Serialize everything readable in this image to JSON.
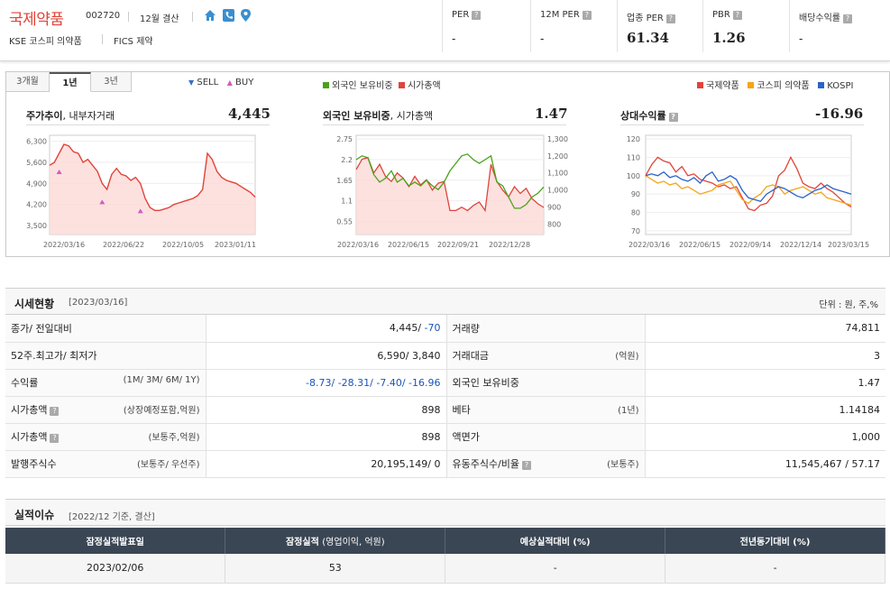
{
  "company": {
    "name": "국제약품",
    "code": "002720",
    "settlement": "12월 결산",
    "market": "KSE  코스피 의약품",
    "fics": "FICS 제약",
    "icons": [
      "home-icon",
      "phone-icon",
      "location-pin-icon"
    ]
  },
  "metrics": [
    {
      "label": "PER",
      "value": "-"
    },
    {
      "label": "12M PER",
      "value": "-"
    },
    {
      "label": "업종 PER",
      "value": "61.34"
    },
    {
      "label": "PBR",
      "value": "1.26"
    },
    {
      "label": "배당수익률",
      "value": "-"
    }
  ],
  "period_tabs": [
    "3개월",
    "1년",
    "3년"
  ],
  "active_tab": "1년",
  "legends": {
    "trade": [
      "SELL",
      "BUY"
    ],
    "foreign": [
      "외국인 보유비중",
      "시가총액"
    ],
    "relative": [
      "국제약품",
      "코스피 의약품",
      "KOSPI"
    ]
  },
  "colors": {
    "red": "#e0443a",
    "green": "#4aa21a",
    "orange": "#f5a418",
    "blue": "#2b63c8",
    "buy": "#d05bc4",
    "sell": "#3a6fc9"
  },
  "charts": {
    "price": {
      "title": "주가추이",
      "subtitle": ", 내부자거래",
      "value": "4,445"
    },
    "foreign": {
      "title": "외국인 보유비중",
      "subtitle": ", 시가총액",
      "value": "1.47"
    },
    "relative": {
      "title": "상대수익률",
      "value": "-16.96"
    }
  },
  "chart_data": [
    {
      "type": "area",
      "title": "주가추이, 내부자거래",
      "x_ticks": [
        "2022/03/16",
        "2022/06/22",
        "2022/10/05",
        "2023/01/11"
      ],
      "y_ticks": [
        6300,
        5600,
        4900,
        4200,
        3500
      ],
      "ylim": [
        3200,
        6500
      ],
      "series": [
        {
          "name": "주가",
          "values": [
            5500,
            5600,
            5900,
            6200,
            6150,
            5950,
            5900,
            5600,
            5700,
            5500,
            5300,
            4900,
            4700,
            5200,
            5400,
            5200,
            5150,
            5000,
            5100,
            4900,
            4400,
            4100,
            4000,
            4000,
            4050,
            4100,
            4200,
            4250,
            4300,
            4350,
            4400,
            4500,
            4700,
            5900,
            5700,
            5300,
            5100,
            5000,
            4950,
            4900,
            4800,
            4700,
            4600,
            4445
          ]
        }
      ],
      "markers": [
        {
          "type": "BUY",
          "index": 2
        },
        {
          "type": "BUY",
          "index": 11
        },
        {
          "type": "BUY",
          "index": 19
        }
      ]
    },
    {
      "type": "line",
      "title": "외국인 보유비중, 시가총액",
      "x_ticks": [
        "2022/03/16",
        "2022/06/15",
        "2022/09/21",
        "2022/12/28"
      ],
      "y_left_ticks": [
        2.75,
        2.2,
        1.65,
        1.1,
        0.55
      ],
      "y_right_ticks": [
        1300,
        1200,
        1100,
        1000,
        900,
        800
      ],
      "series": [
        {
          "name": "외국인 보유비중",
          "values": [
            2.2,
            2.3,
            2.25,
            1.8,
            1.6,
            1.7,
            1.9,
            1.6,
            1.7,
            1.5,
            1.6,
            1.5,
            1.65,
            1.5,
            1.4,
            1.6,
            1.9,
            2.1,
            2.3,
            2.35,
            2.2,
            2.1,
            2.2,
            2.3,
            1.6,
            1.5,
            1.2,
            0.9,
            0.9,
            1.0,
            1.2,
            1.3,
            1.47
          ]
        },
        {
          "name": "시가총액",
          "values": [
            1120,
            1180,
            1190,
            1100,
            1150,
            1080,
            1050,
            1100,
            1070,
            1020,
            1080,
            1030,
            1060,
            1000,
            1040,
            1050,
            880,
            880,
            900,
            880,
            910,
            930,
            880,
            1150,
            1050,
            1000,
            960,
            1020,
            980,
            1010,
            950,
            920,
            898
          ]
        }
      ]
    },
    {
      "type": "line",
      "title": "상대수익률",
      "x_ticks": [
        "2022/03/16",
        "2022/06/15",
        "2022/09/14",
        "2022/12/14",
        "2023/03/15"
      ],
      "y_ticks": [
        120,
        110,
        100,
        90,
        80,
        70
      ],
      "series": [
        {
          "name": "국제약품",
          "values": [
            100,
            106,
            110,
            108,
            107,
            102,
            105,
            100,
            101,
            98,
            97,
            96,
            94,
            95,
            93,
            94,
            88,
            82,
            81,
            84,
            85,
            89,
            100,
            103,
            110,
            104,
            96,
            94,
            93,
            96,
            93,
            91,
            88,
            85,
            83
          ]
        },
        {
          "name": "코스피 의약품",
          "values": [
            100,
            98,
            96,
            97,
            95,
            96,
            93,
            94,
            92,
            90,
            91,
            92,
            95,
            96,
            97,
            92,
            87,
            85,
            88,
            90,
            94,
            95,
            94,
            90,
            92,
            93,
            94,
            92,
            90,
            91,
            88,
            87,
            86,
            85,
            84
          ]
        },
        {
          "name": "KOSPI",
          "values": [
            100,
            101,
            100,
            102,
            99,
            100,
            98,
            97,
            99,
            96,
            100,
            102,
            97,
            98,
            100,
            98,
            92,
            88,
            87,
            86,
            90,
            92,
            94,
            93,
            91,
            89,
            88,
            90,
            92,
            93,
            95,
            93,
            92,
            91,
            90
          ]
        }
      ]
    }
  ],
  "market_status": {
    "title": "시세현황",
    "date": "[2023/03/16]",
    "unit": "단위 : 원, 주,%",
    "rows": [
      {
        "l_label": "종가/ 전일대비",
        "l_hint": "",
        "l_value": "4,445/",
        "l_value2": " -70",
        "r_label": "거래량",
        "r_hint": "",
        "r_value": "74,811"
      },
      {
        "l_label": "52주.최고가/ 최저가",
        "l_hint": "",
        "l_value": "6,590/ 3,840",
        "l_value2": "",
        "r_label": "거래대금",
        "r_hint": "(억원)",
        "r_value": "3"
      },
      {
        "l_label": "수익률",
        "l_hint": "(1M/ 3M/ 6M/ 1Y)",
        "l_value": "",
        "l_value2": "-8.73/ -28.31/ -7.40/ -16.96",
        "r_label": "외국인 보유비중",
        "r_hint": "",
        "r_value": "1.47"
      },
      {
        "l_label": "시가총액",
        "l_hint": "(상장예정포함,억원)",
        "l_value": "898",
        "l_value2": "",
        "r_label": "베타",
        "r_hint": "(1년)",
        "r_value": "1.14184"
      },
      {
        "l_label": "시가총액",
        "l_hint": "(보통주,억원)",
        "l_value": "898",
        "l_value2": "",
        "r_label": "액면가",
        "r_hint": "",
        "r_value": "1,000"
      },
      {
        "l_label": "발행주식수",
        "l_hint": "(보통주/ 우선주)",
        "l_value": "20,195,149/ 0",
        "l_value2": "",
        "r_label": "유동주식수/비율",
        "r_hint": "(보통주)",
        "r_value": "11,545,467 / 57.17"
      }
    ]
  },
  "earnings": {
    "title": "실적이슈",
    "date": "[2022/12 기준, 결산]",
    "headers": [
      "잠정실적발표일",
      "잠정실적",
      "(영업이익, 억원)",
      "예상실적대비 (%)",
      "전년동기대비 (%)"
    ],
    "row": [
      "2023/02/06",
      "53",
      "-",
      "-"
    ]
  }
}
